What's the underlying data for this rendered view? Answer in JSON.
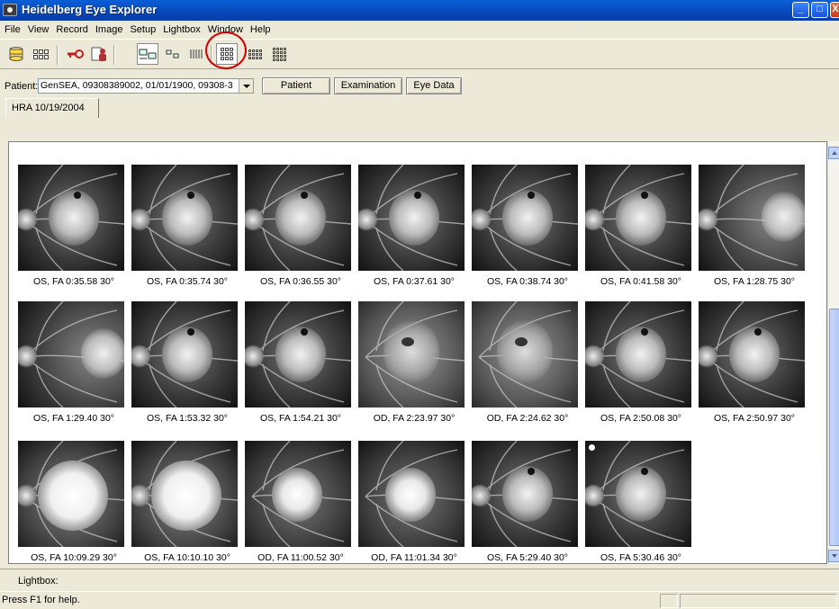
{
  "window": {
    "title": "Heidelberg Eye Explorer",
    "minimize": "_",
    "maximize": "□",
    "close": "X"
  },
  "menu": [
    "File",
    "View",
    "Record",
    "Image",
    "Setup",
    "Lightbox",
    "Window",
    "Help"
  ],
  "patient": {
    "label": "Patient:",
    "selected": "GenSEA, 09308389002, 01/01/1900, 09308-3",
    "buttons": {
      "patient": "Patient",
      "examination": "Examination",
      "eye_data": "Eye Data"
    }
  },
  "tabs": [
    {
      "label": "HRA 10/19/2004"
    }
  ],
  "thumbnails": [
    {
      "caption": "OS, FA 0:35.58 30°",
      "style": "late"
    },
    {
      "caption": "OS, FA 0:35.74 30°",
      "style": "late"
    },
    {
      "caption": "OS, FA 0:36.55 30°",
      "style": "late"
    },
    {
      "caption": "OS, FA 0:37.61 30°",
      "style": "late"
    },
    {
      "caption": "OS, FA 0:38.74 30°",
      "style": "late"
    },
    {
      "caption": "OS, FA 0:41.58 30°",
      "style": "late"
    },
    {
      "caption": "OS, FA 1:28.75 30°",
      "style": "peripheral"
    },
    {
      "caption": "OS, FA 1:29.40 30°",
      "style": "peripheral"
    },
    {
      "caption": "OS, FA 1:53.32 30°",
      "style": "late"
    },
    {
      "caption": "OS, FA 1:54.21 30°",
      "style": "late"
    },
    {
      "caption": "OD, FA 2:23.97 30°",
      "style": "haze"
    },
    {
      "caption": "OD, FA 2:24.62 30°",
      "style": "haze"
    },
    {
      "caption": "OS, FA 2:50.08 30°",
      "style": "late"
    },
    {
      "caption": "OS, FA 2:50.97 30°",
      "style": "late"
    },
    {
      "caption": "OS, FA 10:09.29 30°",
      "style": "bright"
    },
    {
      "caption": "OS, FA 10:10.10 30°",
      "style": "bright"
    },
    {
      "caption": "OD, FA 11:00.52 30°",
      "style": "haze-bright"
    },
    {
      "caption": "OD, FA 11:01.34 30°",
      "style": "haze-bright"
    },
    {
      "caption": "OS, FA 5:29.40 30°",
      "style": "late"
    },
    {
      "caption": "OS, FA 5:30.46 30°",
      "style": "late",
      "marker": true
    }
  ],
  "lightbox": {
    "label": "Lightbox:"
  },
  "status": {
    "text": "Press F1 for help."
  },
  "colors": {
    "titlebar": "#0747b8",
    "highlight_ring": "#d10000",
    "window_bg": "#ece9d8"
  }
}
